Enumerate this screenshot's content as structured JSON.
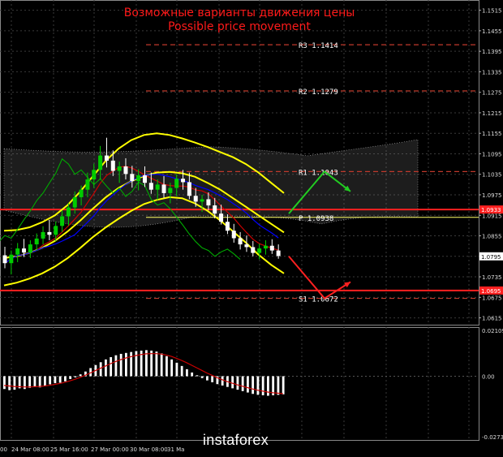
{
  "title_ru": "Возможные варианты движения цены",
  "title_en": "Possible price movement",
  "logo_text": "instaforex",
  "colors": {
    "background": "#000000",
    "grid": "#3a3a3a",
    "title": "#ff1a1a",
    "candle_up": "#00cc00",
    "candle_down": "#ffffff",
    "bollinger": "#ffff00",
    "ma_red": "#cc0000",
    "kijun": "#0000ff",
    "chikou": "#00aa00",
    "cloud": "#a0a0a0",
    "pivot_dash": "#c0392b",
    "level_line": "#ff2020",
    "pivot_line": "#ffff66",
    "arrow_up": "#22cc22",
    "arrow_down": "#ff2020",
    "macd_hist": "#ffffff",
    "macd_signal": "#cc0000"
  },
  "chart_data": [
    {
      "type": "line",
      "panel": "price",
      "instrument_labels": {
        "y_ticks": [
          "1.1515",
          "1.1455",
          "1.1395",
          "1.1335",
          "1.1275",
          "1.1215",
          "1.1155",
          "1.1095",
          "1.1035",
          "1.0975",
          "1.0915",
          "1.0855",
          "1.0795",
          "1.0735",
          "1.0675",
          "1.0615"
        ],
        "x_ticks": [
          "00",
          "24 Mar 08:00",
          "25 Mar 16:00",
          "27 Mar 00:00",
          "30 Mar 08:00",
          "31 Ma"
        ]
      },
      "ylim": [
        1.0595,
        1.1545
      ],
      "grid": true,
      "pivot_levels": [
        {
          "label": "R3",
          "value": "1.1414",
          "y": 1.1414
        },
        {
          "label": "R2",
          "value": "1.1279",
          "y": 1.1279
        },
        {
          "label": "R1",
          "value": "1.1043",
          "y": 1.1043
        },
        {
          "label": "P",
          "value": "1.0938",
          "y": 1.0909
        },
        {
          "label": "S1",
          "value": "1.0672",
          "y": 1.0672
        }
      ],
      "price_tags": [
        {
          "value": "1.0933",
          "y": 1.0932,
          "color": "#ff2020"
        },
        {
          "value": "1.0795",
          "y": 1.0795,
          "color": "#ffffff"
        },
        {
          "value": "1.0695",
          "y": 1.0695,
          "color": "#ff2020"
        }
      ],
      "horizontal_levels": [
        1.0932,
        1.0695
      ],
      "candles": [
        [
          1.0798,
          1.0823,
          1.076,
          1.0775
        ],
        [
          1.0775,
          1.0812,
          1.0742,
          1.08
        ],
        [
          1.08,
          1.0834,
          1.0778,
          1.0818
        ],
        [
          1.0818,
          1.0846,
          1.0793,
          1.0806
        ],
        [
          1.0806,
          1.0842,
          1.079,
          1.083
        ],
        [
          1.083,
          1.0862,
          1.0812,
          1.0847
        ],
        [
          1.0847,
          1.0883,
          1.083,
          1.0866
        ],
        [
          1.0866,
          1.0901,
          1.0842,
          1.0858
        ],
        [
          1.0858,
          1.0897,
          1.084,
          1.0884
        ],
        [
          1.0884,
          1.0929,
          1.0866,
          1.0912
        ],
        [
          1.0912,
          1.095,
          1.0885,
          1.0938
        ],
        [
          1.0938,
          1.0985,
          1.092,
          1.0968
        ],
        [
          1.0968,
          1.1002,
          1.0944,
          1.099
        ],
        [
          1.099,
          1.104,
          1.0968,
          1.102
        ],
        [
          1.102,
          1.1066,
          1.0995,
          1.1048
        ],
        [
          1.1048,
          1.1118,
          1.102,
          1.109
        ],
        [
          1.109,
          1.1142,
          1.1055,
          1.1075
        ],
        [
          1.1075,
          1.1105,
          1.103,
          1.1045
        ],
        [
          1.1045,
          1.1072,
          1.101,
          1.1058
        ],
        [
          1.1058,
          1.1082,
          1.102,
          1.1036
        ],
        [
          1.1036,
          1.106,
          1.0996,
          1.1015
        ],
        [
          1.1015,
          1.105,
          1.0988,
          1.1032
        ],
        [
          1.1032,
          1.1058,
          1.0998,
          1.101
        ],
        [
          1.101,
          1.104,
          1.0978,
          1.099
        ],
        [
          1.099,
          1.102,
          1.096,
          1.1005
        ],
        [
          1.1005,
          1.103,
          1.0966,
          1.098
        ],
        [
          1.098,
          1.101,
          1.095,
          1.0995
        ],
        [
          1.0995,
          1.1035,
          1.0972,
          1.1022
        ],
        [
          1.1022,
          1.1048,
          1.099,
          1.1012
        ],
        [
          1.1012,
          1.104,
          1.0962,
          1.0972
        ],
        [
          1.0972,
          1.0995,
          1.094,
          1.0955
        ],
        [
          1.0955,
          1.0975,
          1.0925,
          1.0962
        ],
        [
          1.0962,
          1.0982,
          1.093,
          1.0944
        ],
        [
          1.0944,
          1.0966,
          1.0906,
          1.092
        ],
        [
          1.092,
          1.0946,
          1.0888,
          1.0896
        ],
        [
          1.0896,
          1.0918,
          1.086,
          1.087
        ],
        [
          1.087,
          1.089,
          1.0835,
          1.0848
        ],
        [
          1.0848,
          1.0866,
          1.0815,
          1.083
        ],
        [
          1.083,
          1.0856,
          1.0808,
          1.0822
        ],
        [
          1.0822,
          1.084,
          1.0795,
          1.0805
        ],
        [
          1.0805,
          1.0832,
          1.0786,
          1.0818
        ],
        [
          1.0818,
          1.0842,
          1.08,
          1.0826
        ],
        [
          1.0826,
          1.0845,
          1.0802,
          1.0812
        ],
        [
          1.0812,
          1.083,
          1.0788,
          1.0796
        ]
      ],
      "bollinger_upper": [
        1.087,
        1.0872,
        1.088,
        1.0895,
        1.0915,
        1.0945,
        1.0985,
        1.103,
        1.1075,
        1.111,
        1.1135,
        1.115,
        1.1155,
        1.115,
        1.114,
        1.1128,
        1.1115,
        1.11,
        1.1085,
        1.1065,
        1.104,
        1.101,
        1.098
      ],
      "bollinger_middle": [
        1.079,
        1.0795,
        1.0805,
        1.082,
        1.084,
        1.0868,
        1.09,
        1.0935,
        1.0968,
        1.0995,
        1.1015,
        1.103,
        1.104,
        1.1042,
        1.1038,
        1.1028,
        1.101,
        1.099,
        1.0965,
        1.094,
        1.0915,
        1.089,
        1.0865
      ],
      "bollinger_lower": [
        1.071,
        1.0718,
        1.073,
        1.0745,
        1.0765,
        1.079,
        1.082,
        1.0852,
        1.088,
        1.0905,
        1.0928,
        1.0948,
        1.096,
        1.0968,
        1.0965,
        1.095,
        1.0928,
        1.09,
        1.0868,
        1.0835,
        1.08,
        1.077,
        1.0745
      ],
      "scenario_up": [
        [
          1.092,
          1.1043
        ],
        [
          1.1043,
          1.0985
        ]
      ],
      "scenario_down": [
        [
          1.0795,
          1.0672
        ],
        [
          1.0672,
          1.072
        ]
      ]
    },
    {
      "type": "bar",
      "panel": "macd",
      "y_ticks": [
        "0.02109",
        "0.00",
        "-0.02739"
      ],
      "ylim": [
        -0.02739,
        0.02109
      ],
      "values": [
        -0.0055,
        -0.006,
        -0.0058,
        -0.0052,
        -0.0055,
        -0.005,
        -0.0045,
        -0.0048,
        -0.004,
        -0.0035,
        -0.003,
        -0.0028,
        -0.0022,
        -0.0012,
        -0.0005,
        0.0008,
        0.002,
        0.0035,
        0.0048,
        0.006,
        0.0072,
        0.0082,
        0.009,
        0.0096,
        0.01,
        0.0104,
        0.0108,
        0.011,
        0.0112,
        0.011,
        0.0106,
        0.0098,
        0.0086,
        0.0072,
        0.0058,
        0.0044,
        0.003,
        0.0016,
        0.0004,
        -0.0008,
        -0.0018,
        -0.0026,
        -0.0034,
        -0.004,
        -0.0046,
        -0.0052,
        -0.0058,
        -0.0064,
        -0.007,
        -0.0076,
        -0.008,
        -0.0082,
        -0.0084,
        -0.0082,
        -0.008,
        -0.0078
      ],
      "signal": [
        -0.004,
        -0.0042,
        -0.0044,
        -0.0045,
        -0.0046,
        -0.0046,
        -0.0045,
        -0.0044,
        -0.0042,
        -0.0039,
        -0.0035,
        -0.0031,
        -0.0026,
        -0.002,
        -0.0013,
        -0.0005,
        0.0004,
        0.0014,
        0.0024,
        0.0034,
        0.0044,
        0.0054,
        0.0063,
        0.0071,
        0.0078,
        0.0084,
        0.0089,
        0.0093,
        0.0096,
        0.0097,
        0.0097,
        0.0095,
        0.0091,
        0.0085,
        0.0077,
        0.0068,
        0.0058,
        0.0047,
        0.0036,
        0.0025,
        0.0014,
        0.0004,
        -0.0006,
        -0.0015,
        -0.0023,
        -0.003,
        -0.0037,
        -0.0043,
        -0.0049,
        -0.0055,
        -0.006,
        -0.0064,
        -0.0068,
        -0.0071,
        -0.0073,
        -0.0075
      ]
    }
  ]
}
